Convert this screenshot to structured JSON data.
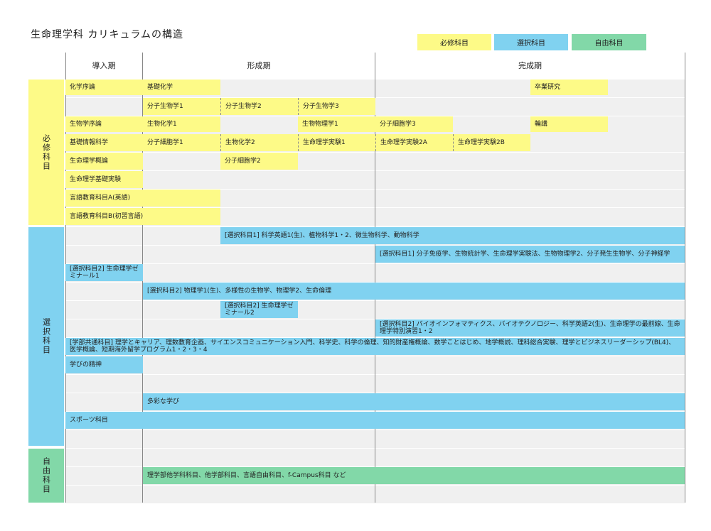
{
  "title": "生命理学科 カリキュラムの構造",
  "colors": {
    "required": "#fdfa87",
    "elective": "#80d2f0",
    "free": "#82d8a8"
  },
  "legend": [
    {
      "label": "必修科目",
      "type": "required"
    },
    {
      "label": "選択科目",
      "type": "elective"
    },
    {
      "label": "自由科目",
      "type": "free"
    }
  ],
  "periods": [
    "導入期",
    "形成期",
    "完成期"
  ],
  "categories": [
    "必修科目",
    "選択科目",
    "自由科目"
  ],
  "cells": [
    {
      "text": "化学序論",
      "type": "required"
    },
    {
      "text": "基礎化学",
      "type": "required"
    },
    {
      "text": "卒業研究",
      "type": "required"
    },
    {
      "text": "分子生物学1",
      "type": "required"
    },
    {
      "text": "分子生物学2",
      "type": "required"
    },
    {
      "text": "分子生物学3",
      "type": "required"
    },
    {
      "text": "生物学序論",
      "type": "required"
    },
    {
      "text": "生物化学1",
      "type": "required"
    },
    {
      "text": "生物物理学1",
      "type": "required"
    },
    {
      "text": "分子細胞学3",
      "type": "required"
    },
    {
      "text": "輪講",
      "type": "required"
    },
    {
      "text": "基礎情報科学",
      "type": "required"
    },
    {
      "text": "分子細胞学1",
      "type": "required"
    },
    {
      "text": "生物化学2",
      "type": "required"
    },
    {
      "text": "生命理学実験1",
      "type": "required"
    },
    {
      "text": "生命理学実験2A",
      "type": "required"
    },
    {
      "text": "生命理学実験2B",
      "type": "required"
    },
    {
      "text": "生命理学概論",
      "type": "required"
    },
    {
      "text": "分子細胞学2",
      "type": "required"
    },
    {
      "text": "生命理学基礎実験",
      "type": "required"
    },
    {
      "text": "言語教育科目A(英語)",
      "type": "required"
    },
    {
      "text": "言語教育科目B(初習言語)",
      "type": "required"
    },
    {
      "text": "[選択科目1] 科学英語1(生)、植物科学1・2、微生物科学、動物科学",
      "type": "elective"
    },
    {
      "text": "[選択科目1] 分子免疫学、生物統計学、生命理学実験法、生物物理学2、分子発生生物学、分子神経学",
      "type": "elective"
    },
    {
      "text": "[選択科目2] 生命理学ゼミナール1",
      "type": "elective"
    },
    {
      "text": "[選択科目2] 物理学1(生)、多様性の生物学、物理学2、生命倫理",
      "type": "elective"
    },
    {
      "text": "[選択科目2] 生命理学ゼミナール2",
      "type": "elective"
    },
    {
      "text": "[選択科目2] バイオインフォマティクス、バイオテクノロジー、科学英語2(生)、生命理学の最前線、生命理学特別演習1・2",
      "type": "elective"
    },
    {
      "text": "[学部共通科目] 理学とキャリア、理数教育企画、サイエンスコミュニケーション入門、科学史、科学の倫理、知的財産権概論、数学ことはじめ、地学概説、理科総合実験、理学とビジネスリーダーシップ(BL4)、医学概論、短期海外留学プログラム1・2・3・4",
      "type": "elective"
    },
    {
      "text": "学びの精神",
      "type": "elective"
    },
    {
      "text": "多彩な学び",
      "type": "elective"
    },
    {
      "text": "スポーツ科目",
      "type": "elective"
    },
    {
      "text": "理学部他学科科目、他学部科目、言語自由科目、f-Campus科目 など",
      "type": "free"
    }
  ]
}
